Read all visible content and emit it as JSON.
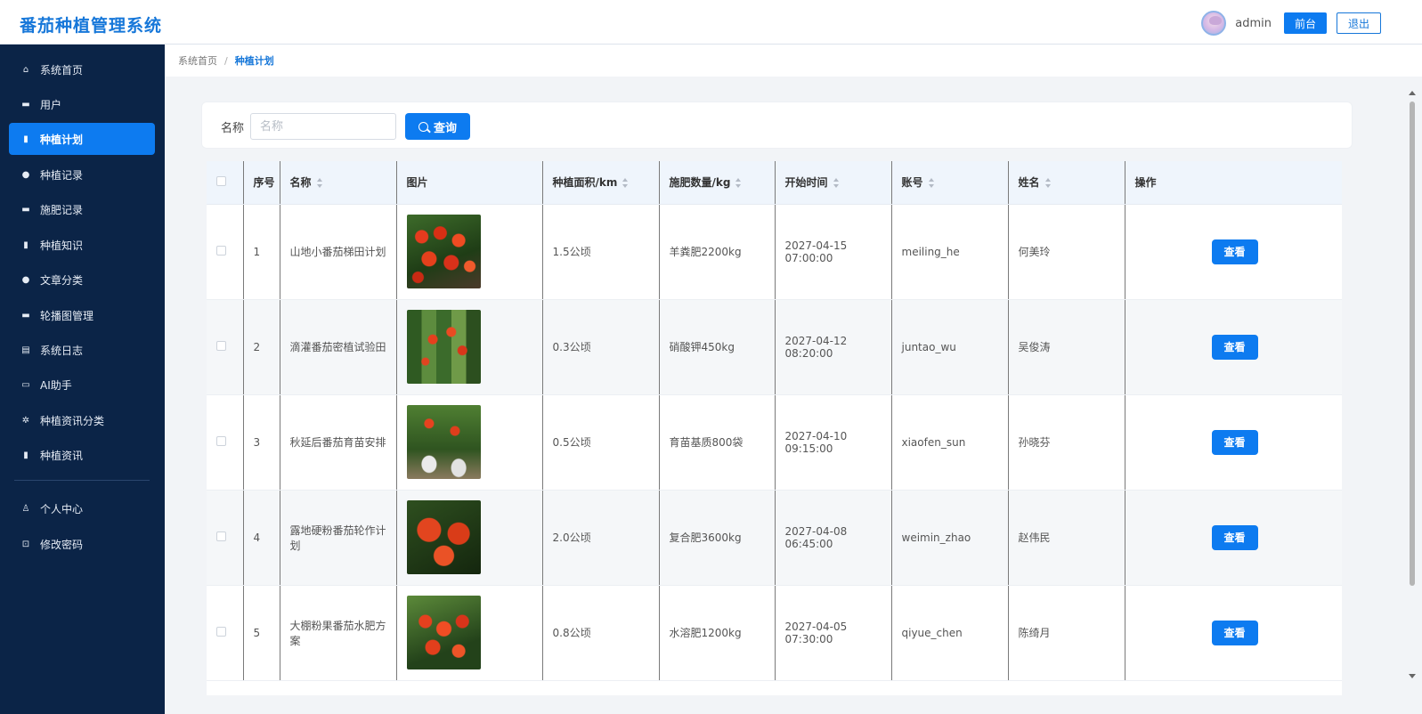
{
  "app": {
    "title": "番茄种植管理系统"
  },
  "header": {
    "username": "admin",
    "front_label": "前台",
    "logout_label": "退出"
  },
  "sidebar": {
    "items": [
      {
        "label": "系统首页",
        "icon": "home-icon",
        "glyph": "⌂"
      },
      {
        "label": "用户",
        "icon": "briefcase-icon",
        "glyph": "▬"
      },
      {
        "label": "种植计划",
        "icon": "bar-chart-icon",
        "glyph": "▮"
      },
      {
        "label": "种植记录",
        "icon": "map-pin-icon",
        "glyph": "●"
      },
      {
        "label": "施肥记录",
        "icon": "briefcase-icon",
        "glyph": "▬"
      },
      {
        "label": "种植知识",
        "icon": "bar-chart-icon",
        "glyph": "▮"
      },
      {
        "label": "文章分类",
        "icon": "map-pin-icon",
        "glyph": "●"
      },
      {
        "label": "轮播图管理",
        "icon": "briefcase-icon",
        "glyph": "▬"
      },
      {
        "label": "系统日志",
        "icon": "clipboard-icon",
        "glyph": "▤"
      },
      {
        "label": "AI助手",
        "icon": "monitor-icon",
        "glyph": "▭"
      },
      {
        "label": "种植资讯分类",
        "icon": "gear-icon",
        "glyph": "✲"
      },
      {
        "label": "种植资讯",
        "icon": "bar-chart-icon",
        "glyph": "▮"
      },
      {
        "label": "个人中心",
        "icon": "user-icon",
        "glyph": "♙"
      },
      {
        "label": "修改密码",
        "icon": "lock-icon",
        "glyph": "⊡"
      }
    ],
    "active_index": 2
  },
  "breadcrumb": {
    "home": "系统首页",
    "separator": "/",
    "current": "种植计划"
  },
  "search": {
    "label": "名称",
    "placeholder": "名称",
    "value": "",
    "button_label": "查询"
  },
  "table": {
    "columns": [
      "序号",
      "名称",
      "图片",
      "种植面积/km",
      "施肥数量/kg",
      "开始时间",
      "账号",
      "姓名",
      "操作"
    ],
    "view_label": "查看",
    "rows": [
      {
        "index": "1",
        "name": "山地小番茄梯田计划",
        "area": "1.5公顷",
        "fertilizer": "羊粪肥2200kg",
        "start_time": "2027-04-15 07:00:00",
        "account": "meiling_he",
        "person": "何美玲"
      },
      {
        "index": "2",
        "name": "滴灌番茄密植试验田",
        "area": "0.3公顷",
        "fertilizer": "硝酸钾450kg",
        "start_time": "2027-04-12 08:20:00",
        "account": "juntao_wu",
        "person": "吴俊涛"
      },
      {
        "index": "3",
        "name": "秋延后番茄育苗安排",
        "area": "0.5公顷",
        "fertilizer": "育苗基质800袋",
        "start_time": "2027-04-10 09:15:00",
        "account": "xiaofen_sun",
        "person": "孙晓芬"
      },
      {
        "index": "4",
        "name": "露地硬粉番茄轮作计划",
        "area": "2.0公顷",
        "fertilizer": "复合肥3600kg",
        "start_time": "2027-04-08 06:45:00",
        "account": "weimin_zhao",
        "person": "赵伟民"
      },
      {
        "index": "5",
        "name": "大棚粉果番茄水肥方案",
        "area": "0.8公顷",
        "fertilizer": "水溶肥1200kg",
        "start_time": "2027-04-05 07:30:00",
        "account": "qiyue_chen",
        "person": "陈绮月"
      }
    ]
  },
  "colors": {
    "primary": "#0d7bf0",
    "sidebar_bg": "#0b2447",
    "title": "#1677d9"
  }
}
